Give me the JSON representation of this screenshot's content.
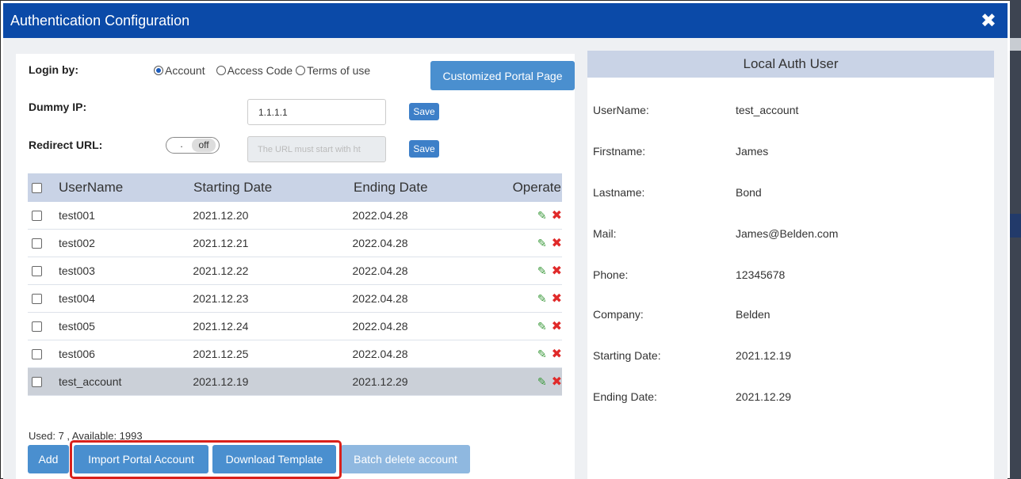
{
  "window": {
    "title": "Authentication Configuration",
    "close_glyph": "✖"
  },
  "login": {
    "label": "Login by:",
    "options": [
      "Account",
      "Access Code",
      "Terms of use"
    ],
    "selected": "Account",
    "portal_button": "Customized Portal Page"
  },
  "dummy_ip": {
    "label": "Dummy IP:",
    "value": "1.1.1.1",
    "save_label": "Save"
  },
  "redirect": {
    "label": "Redirect URL:",
    "toggle_knob": ".",
    "toggle_state": "off",
    "placeholder": "The URL must start with ht",
    "save_label": "Save"
  },
  "table": {
    "headers": [
      "UserName",
      "Starting Date",
      "Ending Date",
      "Operate"
    ],
    "rows": [
      {
        "user": "test001",
        "start": "2021.12.20",
        "end": "2022.04.28"
      },
      {
        "user": "test002",
        "start": "2021.12.21",
        "end": "2022.04.28"
      },
      {
        "user": "test003",
        "start": "2021.12.22",
        "end": "2022.04.28"
      },
      {
        "user": "test004",
        "start": "2021.12.23",
        "end": "2022.04.28"
      },
      {
        "user": "test005",
        "start": "2021.12.24",
        "end": "2022.04.28"
      },
      {
        "user": "test006",
        "start": "2021.12.25",
        "end": "2022.04.28"
      },
      {
        "user": "test_account",
        "start": "2021.12.19",
        "end": "2021.12.29"
      }
    ],
    "selected_row": 6,
    "edit_icon": "pencil-icon",
    "delete_icon": "delete-x-icon"
  },
  "usage": {
    "text": "Used: 7 , Available: 1993"
  },
  "buttons": {
    "add": "Add",
    "import": "Import Portal Account",
    "download": "Download Template",
    "batch_delete": "Batch delete account"
  },
  "local_auth": {
    "title": "Local Auth User",
    "fields": [
      {
        "label": "UserName:",
        "value": "test_account"
      },
      {
        "label": "Firstname:",
        "value": "James"
      },
      {
        "label": "Lastname:",
        "value": "Bond"
      },
      {
        "label": "Mail:",
        "value": "James@Belden.com"
      },
      {
        "label": "Phone:",
        "value": "12345678"
      },
      {
        "label": "Company:",
        "value": "Belden"
      },
      {
        "label": "Starting Date:",
        "value": "2021.12.19"
      },
      {
        "label": "Ending Date:",
        "value": "2021.12.29"
      }
    ]
  },
  "colors": {
    "titlebar": "#0b4aa8",
    "table_header": "#c9d3e6",
    "button_blue": "#4a8fcf",
    "button_disabled": "#8fb8e0",
    "highlight_border": "#d9201b"
  }
}
